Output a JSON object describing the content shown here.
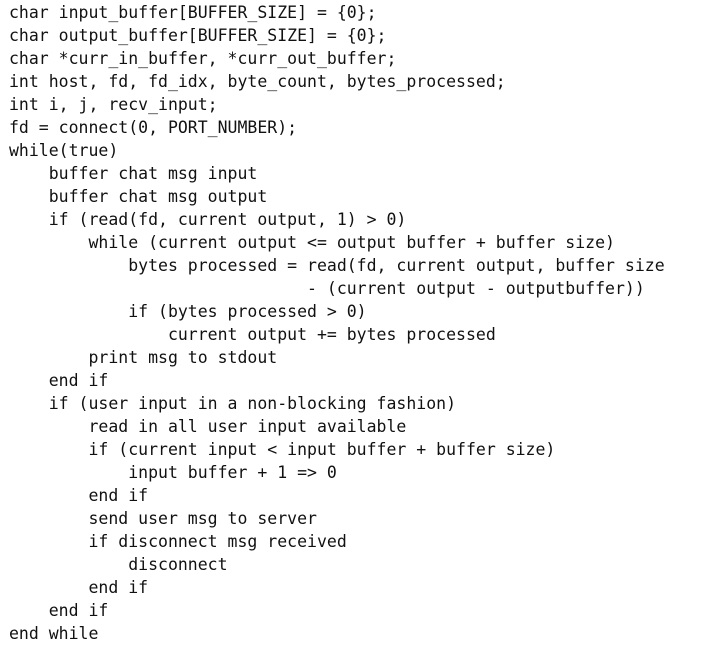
{
  "code": {
    "lines": [
      "char input_buffer[BUFFER_SIZE] = {0};",
      "char output_buffer[BUFFER_SIZE] = {0};",
      "char *curr_in_buffer, *curr_out_buffer;",
      "int host, fd, fd_idx, byte_count, bytes_processed;",
      "int i, j, recv_input;",
      "fd = connect(0, PORT_NUMBER);",
      "while(true)",
      "    buffer chat msg input",
      "    buffer chat msg output",
      "    if (read(fd, current output, 1) > 0)",
      "        while (current output <= output buffer + buffer size)",
      "            bytes processed = read(fd, current output, buffer size",
      "                              - (current output - outputbuffer))",
      "            if (bytes processed > 0)",
      "                current output += bytes processed",
      "        print msg to stdout",
      "    end if",
      "    if (user input in a non-blocking fashion)",
      "        read in all user input available",
      "        if (current input < input buffer + buffer size)",
      "            input buffer + 1 => 0",
      "        end if",
      "        send user msg to server",
      "        if disconnect msg received",
      "            disconnect",
      "        end if",
      "    end if",
      "end while"
    ]
  }
}
